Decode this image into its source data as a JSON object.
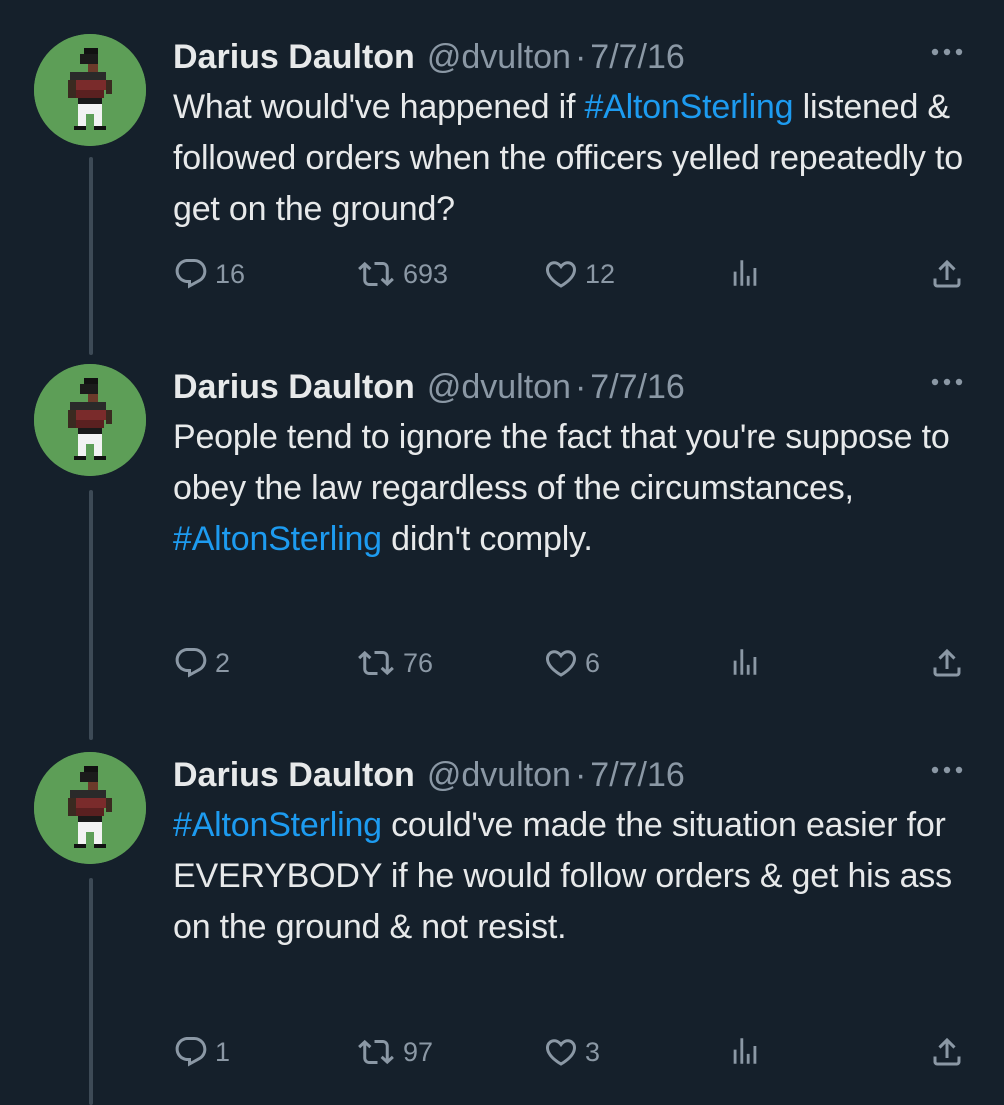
{
  "tweets": [
    {
      "author_name": "Darius Daulton",
      "handle": "@dvulton",
      "separator": "·",
      "date": "7/7/16",
      "text_parts": [
        {
          "text": "What would've happened if ",
          "hashtag": false
        },
        {
          "text": "#AltonSterling",
          "hashtag": true
        },
        {
          "text": " listened & followed orders when the officers yelled repeatedly to get on the ground?",
          "hashtag": false
        }
      ],
      "replies": "16",
      "retweets": "693",
      "likes": "12"
    },
    {
      "author_name": "Darius Daulton",
      "handle": "@dvulton",
      "separator": "·",
      "date": "7/7/16",
      "text_parts": [
        {
          "text": "People tend to ignore the fact that you're suppose to obey the law regardless of the circumstances, ",
          "hashtag": false
        },
        {
          "text": "#AltonSterling",
          "hashtag": true
        },
        {
          "text": " didn't comply.",
          "hashtag": false
        }
      ],
      "replies": "2",
      "retweets": "76",
      "likes": "6"
    },
    {
      "author_name": "Darius Daulton",
      "handle": "@dvulton",
      "separator": "·",
      "date": "7/7/16",
      "text_parts": [
        {
          "text": "#AltonSterling",
          "hashtag": true
        },
        {
          "text": " could've made the situation easier for EVERYBODY if he would follow orders & get his ass on the ground & not resist.",
          "hashtag": false
        }
      ],
      "replies": "1",
      "retweets": "97",
      "likes": "3"
    }
  ],
  "icons": {
    "reply": "reply-icon",
    "retweet": "retweet-icon",
    "like": "heart-icon",
    "views": "views-icon",
    "share": "share-icon",
    "more": "more-icon"
  },
  "colors": {
    "background": "#15202b",
    "text": "#e7e9ea",
    "secondary": "#8b98a5",
    "hashtag": "#1d9bf0",
    "avatar_bg": "#5d9e57"
  }
}
